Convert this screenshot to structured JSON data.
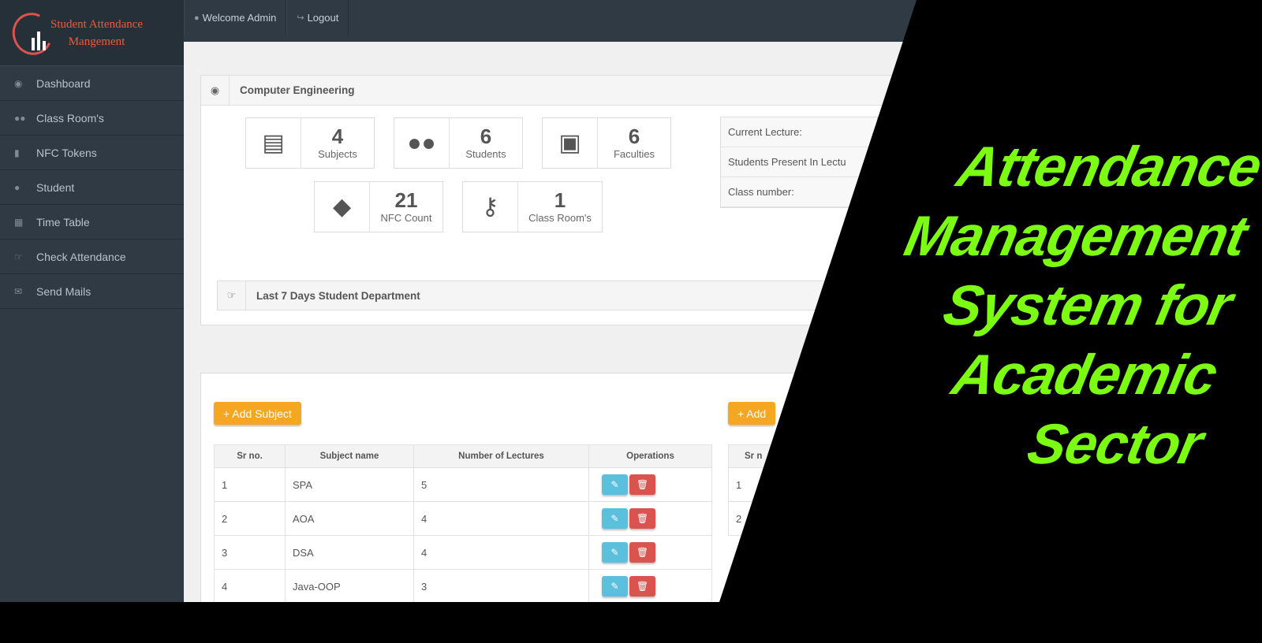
{
  "app": {
    "logo_line1": "Student Attendance",
    "logo_line2": "Mangement"
  },
  "sidebar": {
    "items": [
      {
        "label": "Dashboard",
        "icon": "dashboard-icon"
      },
      {
        "label": "Class Room's",
        "icon": "users-icon"
      },
      {
        "label": "NFC Tokens",
        "icon": "bookmark-icon"
      },
      {
        "label": "Student",
        "icon": "user-icon"
      },
      {
        "label": "Time Table",
        "icon": "calendar-icon"
      },
      {
        "label": "Check Attendance",
        "icon": "hand-point-icon"
      },
      {
        "label": "Send Mails",
        "icon": "envelope-icon"
      }
    ]
  },
  "topbar": {
    "welcome": "Welcome Admin",
    "logout": "Logout"
  },
  "department": {
    "title": "Computer Engineering",
    "stats": [
      {
        "value": "4",
        "label": "Subjects",
        "icon": "book-icon"
      },
      {
        "value": "6",
        "label": "Students",
        "icon": "users-icon"
      },
      {
        "value": "6",
        "label": "Faculties",
        "icon": "briefcase-icon"
      },
      {
        "value": "21",
        "label": "NFC Count",
        "icon": "tags-icon"
      },
      {
        "value": "1",
        "label": "Class Room's",
        "icon": "key-icon"
      }
    ],
    "info": {
      "current_lecture": "Current Lecture:",
      "students_present": "Students Present In Lectu",
      "class_number": "Class number:"
    },
    "last7": "Last 7 Days Student Department"
  },
  "subjects": {
    "add_label": "+ Add Subject",
    "add_label_2": "+ Add",
    "columns": [
      "Sr no.",
      "Subject name",
      "Number of Lectures",
      "Operations"
    ],
    "second_col_header": "Sr n",
    "rows": [
      {
        "sr": "1",
        "name": "SPA",
        "lectures": "5"
      },
      {
        "sr": "2",
        "name": "AOA",
        "lectures": "4"
      },
      {
        "sr": "3",
        "name": "DSA",
        "lectures": "4"
      },
      {
        "sr": "4",
        "name": "Java-OOP",
        "lectures": "3"
      }
    ],
    "second_rows": [
      "1",
      "2"
    ]
  },
  "overlay": {
    "lines": [
      "Attendance",
      "Management",
      "System for",
      "Academic",
      "Sector"
    ],
    "color": "#7cfc12"
  }
}
